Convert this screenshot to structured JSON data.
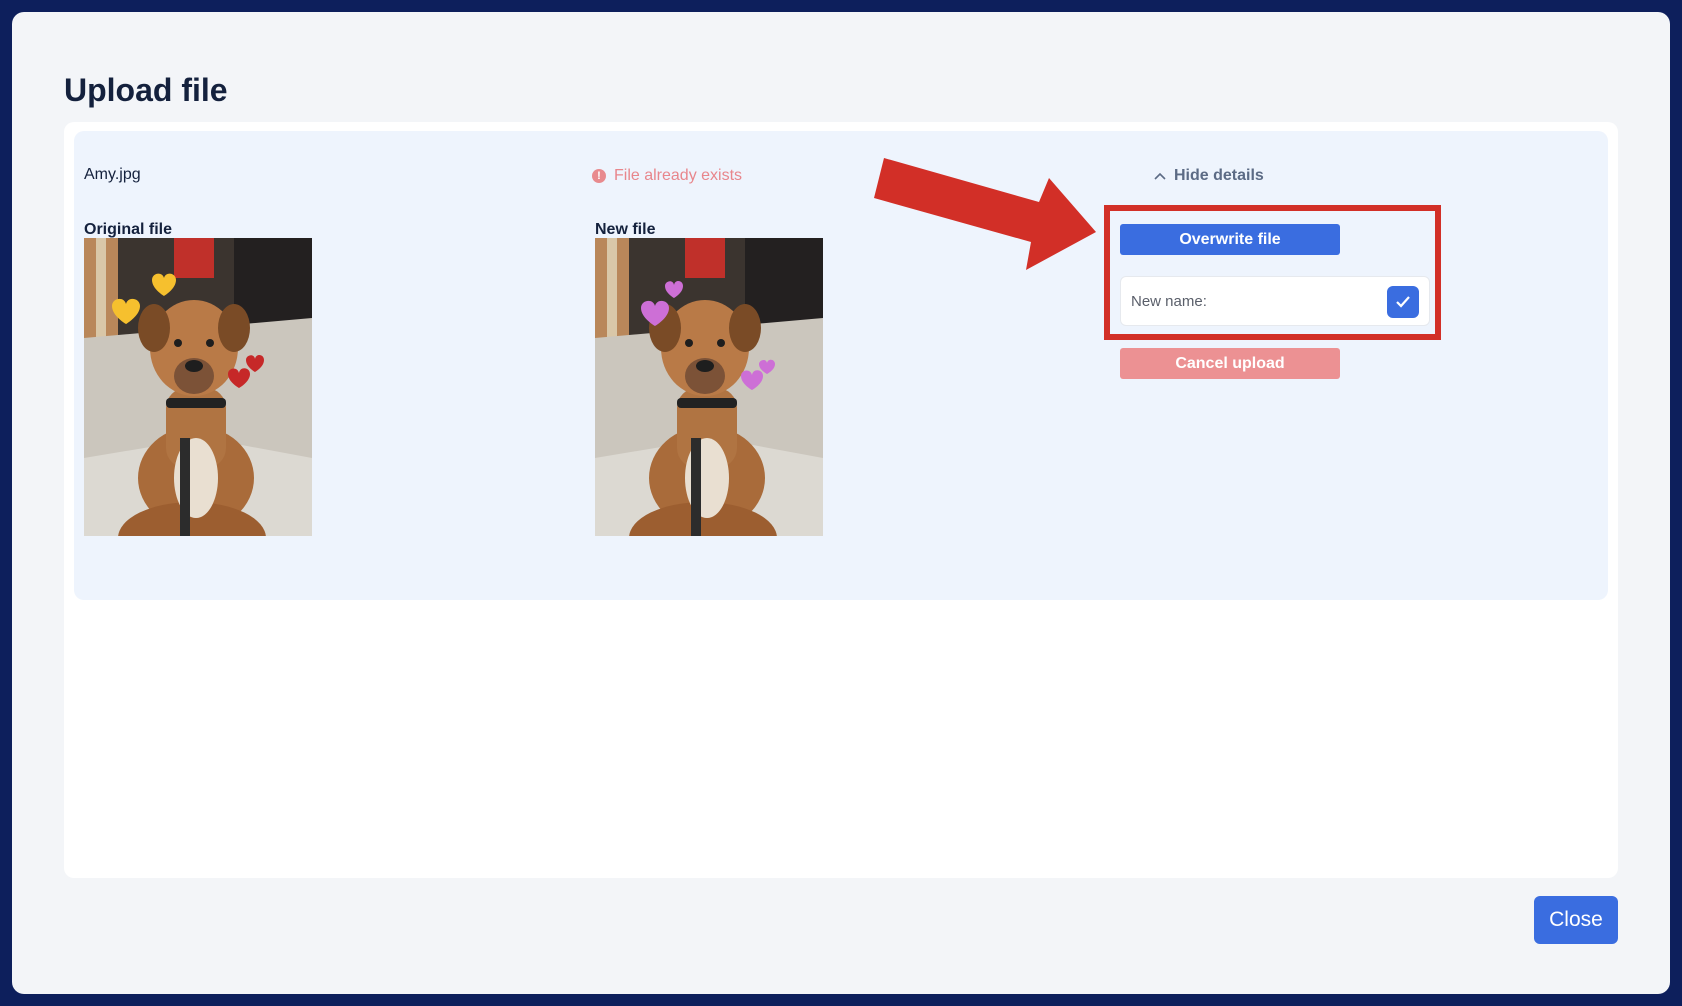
{
  "dialog": {
    "title": "Upload file",
    "close_label": "Close"
  },
  "file": {
    "name": "Amy.jpg",
    "status_text": "File already exists",
    "details_toggle_label": "Hide details"
  },
  "columns": {
    "original_label": "Original file",
    "new_label": "New file"
  },
  "actions": {
    "overwrite_label": "Overwrite file",
    "rename_label": "New name:",
    "rename_value": "",
    "cancel_label": "Cancel upload"
  },
  "colors": {
    "primary": "#3a6de0",
    "danger_soft": "#ec9193",
    "annotation_red": "#d22f27",
    "original_hearts": "#f6c02e",
    "original_hearts_small": "#c62828",
    "new_hearts": "#cd6fd6"
  },
  "icons": {
    "status": "exclamation-circle-icon",
    "toggle": "chevron-up-icon",
    "confirm": "checkmark-icon"
  }
}
